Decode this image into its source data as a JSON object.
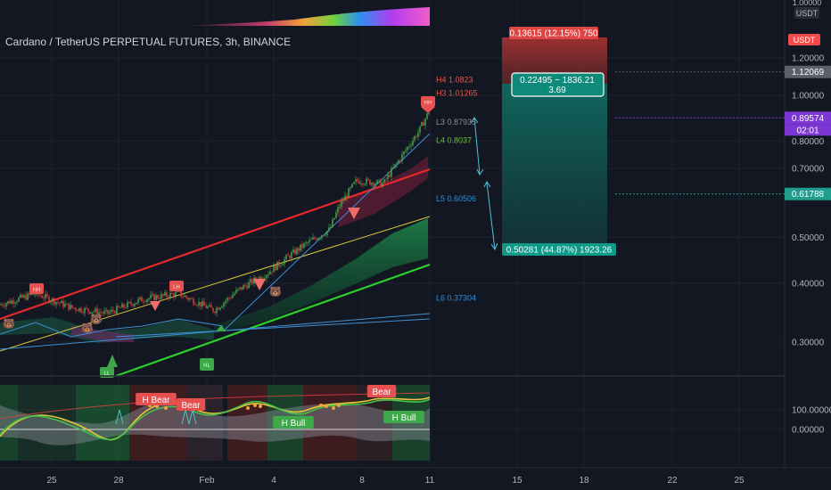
{
  "header": {
    "title": "Cardano / TetherUS PERPETUAL FUTURES, 3h, BINANCE",
    "top_scale_value": "1.00000",
    "currency": "USDT"
  },
  "chart_data": [
    {
      "type": "candlestick",
      "title": "Cardano / TetherUS PERPETUAL FUTURES, 3h, BINANCE",
      "x_tick_labels": [
        "25",
        "28",
        "Feb",
        "4",
        "8",
        "11",
        "15",
        "18",
        "22",
        "25"
      ],
      "y_tick_labels": [
        "1.20000",
        "1.00000",
        "0.80000",
        "0.70000",
        "0.50000",
        "0.40000",
        "0.30000"
      ],
      "ylim": [
        0.27,
        1.3
      ],
      "scale": "log",
      "price_labels": [
        {
          "text": "1.12069",
          "value": 1.12069,
          "color": "#5d606b"
        },
        {
          "text": "0.89574",
          "value": 0.89574,
          "countdown": "02:01",
          "color": "#7b36d4"
        },
        {
          "text": "0.61788",
          "value": 0.61788,
          "color": "#1f9e8e"
        }
      ],
      "level_labels": [
        {
          "text": "H4 1.0823",
          "value": 1.0823,
          "color": "#e8574c"
        },
        {
          "text": "H3 1.01265",
          "value": 1.01265,
          "color": "#e8574c"
        },
        {
          "text": "L3 0.87935",
          "value": 0.87935,
          "color": "#8e8e8e"
        },
        {
          "text": "L4 0.8037",
          "value": 0.8037,
          "color": "#6abf3d"
        },
        {
          "text": "L5 0.60506",
          "value": 0.60506,
          "color": "#2f8fd8"
        },
        {
          "text": "L6 0.37304",
          "value": 0.37304,
          "color": "#2f8fd8"
        }
      ],
      "position_tool": {
        "target_label": "0.13615 (12.15%) 750",
        "entry_label_line1": "0.22495 ~ 1836.21",
        "entry_label_line2": "3.69",
        "stop_label": "0.50281 (44.87%) 1923.26",
        "entry": 1.12069,
        "target": 1.25684,
        "stop": 0.61788
      },
      "markers": [
        "HH",
        "LH",
        "HH",
        "LL",
        "HL"
      ]
    },
    {
      "type": "line",
      "title": "",
      "y_tick_labels": [
        "100.00000",
        "0.00000"
      ],
      "ylim": [
        -60,
        110
      ],
      "signal_labels": [
        "H Bear",
        "Bear",
        "H Bull",
        "Bear",
        "H Bull"
      ]
    }
  ],
  "colors": {
    "background": "#131722",
    "up_candle": "#4caf50",
    "down_candle": "#e84040",
    "red_channel": "#e8282b",
    "green_channel": "#2bd12b",
    "blue_line": "#3d8fd6",
    "yellow_line": "#d8c83a",
    "position_red": "#a03030",
    "position_green": "#0f6b62"
  }
}
